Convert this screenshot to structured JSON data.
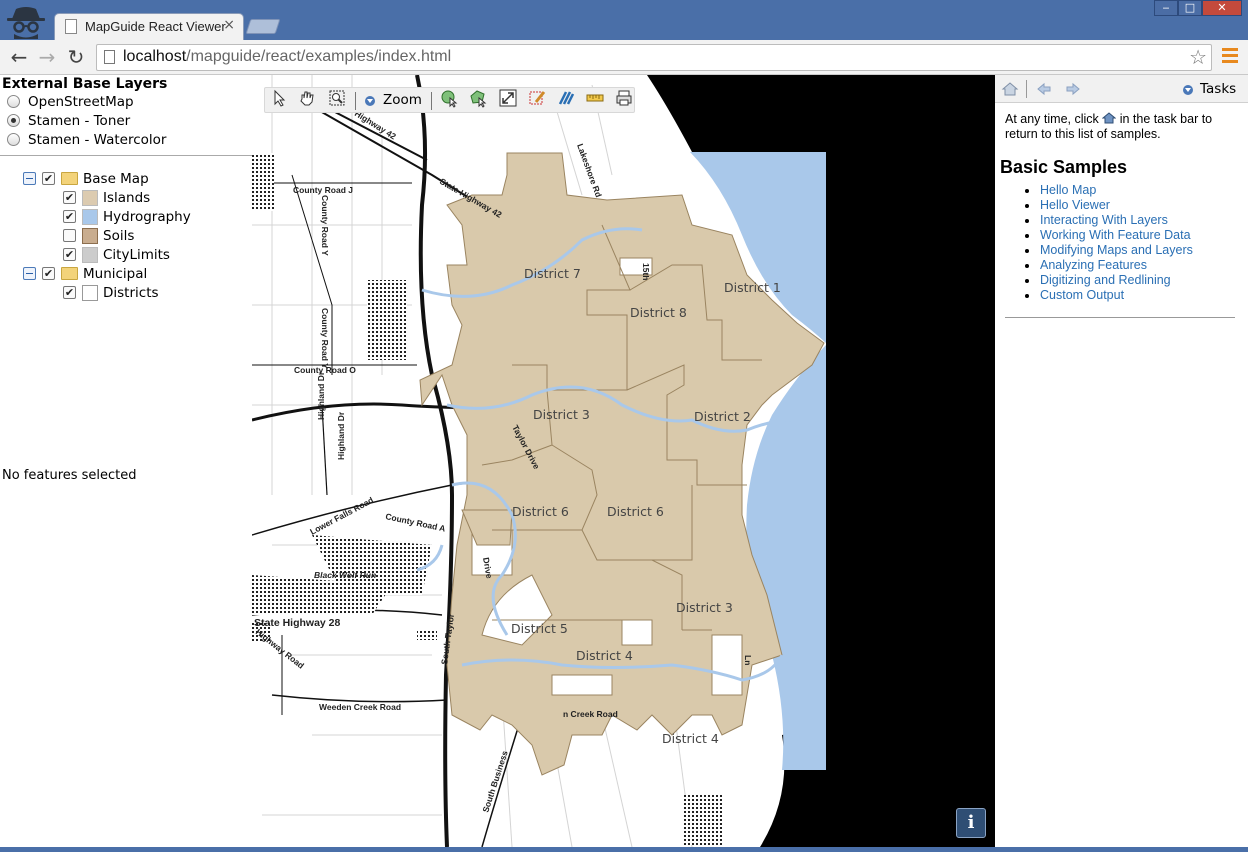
{
  "browser": {
    "tab_title": "MapGuide React Viewer",
    "tab_close": "×",
    "url_host": "localhost",
    "url_path": "/mapguide/react/examples/index.html",
    "window_controls": {
      "minimize": "‒",
      "maximize": "□",
      "close": "✕"
    }
  },
  "left_panel": {
    "external_title": "External Base Layers",
    "base_layers": [
      {
        "label": "OpenStreetMap",
        "selected": false
      },
      {
        "label": "Stamen - Toner",
        "selected": true
      },
      {
        "label": "Stamen - Watercolor",
        "selected": false
      }
    ],
    "legend": {
      "groups": [
        {
          "label": "Base Map",
          "checked": true,
          "layers": [
            {
              "label": "Islands",
              "checked": true,
              "swatch": "#dccbb0"
            },
            {
              "label": "Hydrography",
              "checked": true,
              "swatch": "#a9c8ea"
            },
            {
              "label": "Soils",
              "checked": false,
              "swatch": "#c9ad8f"
            },
            {
              "label": "CityLimits",
              "checked": true,
              "swatch": "#cccccc"
            }
          ]
        },
        {
          "label": "Municipal",
          "checked": true,
          "layers": [
            {
              "label": "Districts",
              "checked": true,
              "swatch": "#ffffff"
            }
          ]
        }
      ]
    },
    "selection_status": "No features selected"
  },
  "map_toolbar": {
    "zoom_label": "Zoom"
  },
  "map": {
    "districts": [
      "District 7",
      "District 1",
      "District 8",
      "District 3",
      "District 2",
      "District 6",
      "District 6",
      "District 3",
      "District 5",
      "District 4",
      "District 4"
    ],
    "roads": [
      "County Road J",
      "County Road Y",
      "County Road Y",
      "County Road O",
      "State Highway 42",
      "Highway 42",
      "Lakeshore Rd",
      "Highland Dr",
      "Highland Dr",
      "Taylor Drive",
      "Lower Falls Road",
      "County Road A",
      "Black Wolf Run",
      "State Highway 28",
      "Highway Road",
      "South Taylor",
      "Weeden Creek Road",
      "n Creek Road",
      "South Business",
      "Drive",
      "15th",
      "Ln"
    ],
    "colors": {
      "district_fill": "#d9c9ab",
      "district_stroke": "#9a8460",
      "water": "#a9c8ea",
      "outside": "#000000"
    },
    "info_button": "i"
  },
  "task_pane": {
    "menu_label": "Tasks",
    "intro_before": "At any time, click ",
    "intro_after": " in the task bar to return to this list of samples.",
    "section_title": "Basic Samples",
    "samples": [
      "Hello Map",
      "Hello Viewer",
      "Interacting With Layers",
      "Working With Feature Data",
      "Modifying Maps and Layers",
      "Analyzing Features",
      "Digitizing and Redlining",
      "Custom Output"
    ]
  }
}
